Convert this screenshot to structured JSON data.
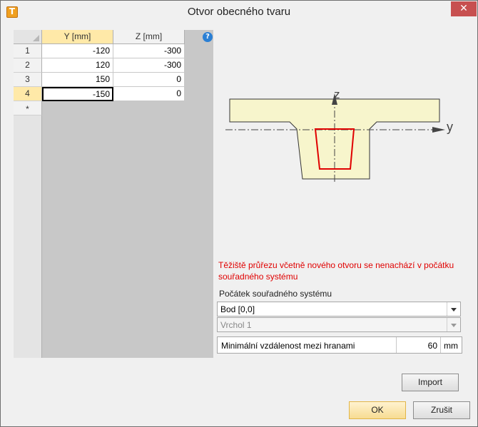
{
  "window": {
    "title": "Otvor obecného tvaru",
    "close_glyph": "✕",
    "app_icon": "T"
  },
  "grid": {
    "columns": [
      "Y [mm]",
      "Z [mm]"
    ],
    "help_glyph": "?",
    "rows": [
      {
        "index": "1",
        "y": "-120",
        "z": "-300"
      },
      {
        "index": "2",
        "y": "120",
        "z": "-300"
      },
      {
        "index": "3",
        "y": "150",
        "z": "0"
      },
      {
        "index": "4",
        "y": "-150",
        "z": "0"
      }
    ],
    "new_row_marker": "*"
  },
  "diagram": {
    "axis_z": "z",
    "axis_y": "y"
  },
  "warning": "Těžiště průřezu včetně nového otvoru se nenachází v počátku souřadného systému",
  "origin": {
    "label": "Počátek souřadného systému",
    "point_value": "Bod [0,0]",
    "vertex_value": "Vrchol 1"
  },
  "min_distance": {
    "label": "Minimální vzdálenost mezi hranami",
    "value": "60",
    "unit": "mm"
  },
  "buttons": {
    "import": "Import",
    "ok": "OK",
    "cancel": "Zrušit"
  },
  "colors": {
    "section_fill": "#f7f5cc",
    "opening_stroke": "#e00000",
    "warning": "#e00000"
  }
}
